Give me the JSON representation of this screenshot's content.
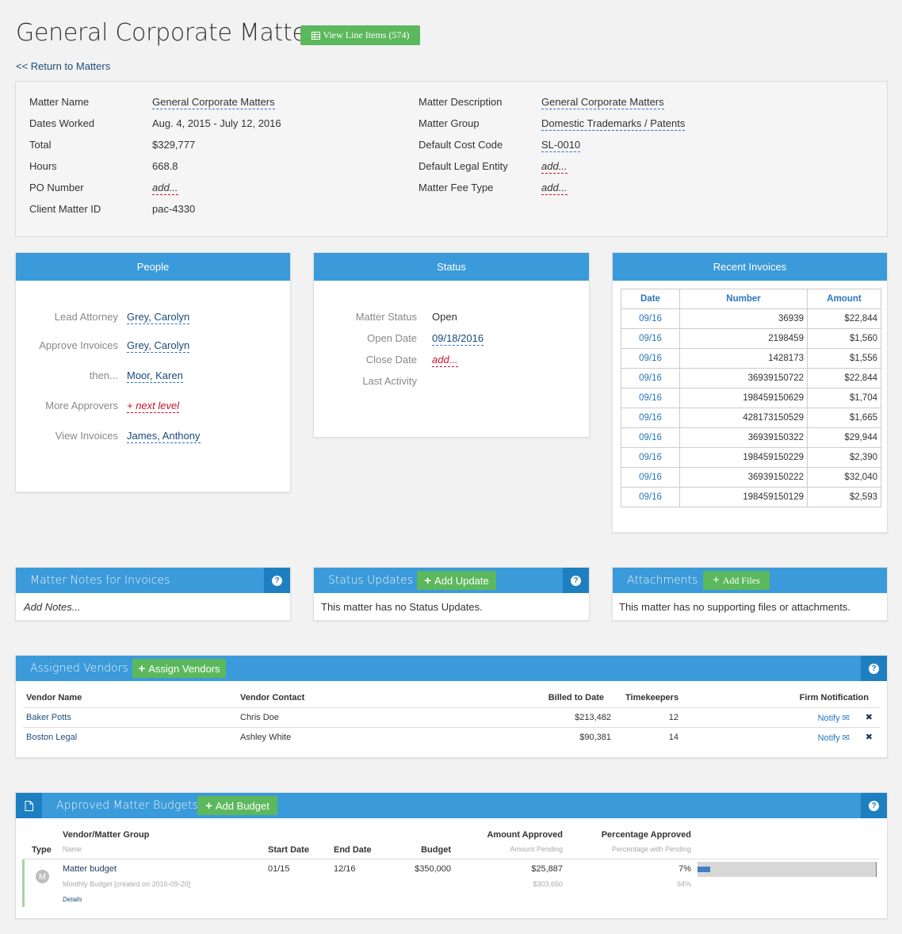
{
  "header": {
    "title": "General Corporate Matters",
    "view_line_items": "View Line Items (574)",
    "return_link": "<< Return to Matters"
  },
  "details": {
    "left": [
      {
        "label": "Matter Name",
        "value": "General Corporate Matters"
      },
      {
        "label": "Dates Worked",
        "value": "Aug. 4, 2015 - July 12, 2016"
      },
      {
        "label": "Total",
        "value": "$329,777"
      },
      {
        "label": "Hours",
        "value": "668.8"
      },
      {
        "label": "PO Number",
        "value": "add..."
      },
      {
        "label": "Client Matter ID",
        "value": "pac-4330"
      }
    ],
    "right": [
      {
        "label": "Matter Description",
        "value": "General Corporate Matters"
      },
      {
        "label": "Matter Group",
        "value": "Domestic Trademarks / Patents"
      },
      {
        "label": "Default Cost Code",
        "value": "SL-0010"
      },
      {
        "label": "Default Legal Entity",
        "value": "add..."
      },
      {
        "label": "Matter Fee Type",
        "value": "add..."
      }
    ]
  },
  "people": {
    "title": "People",
    "rows": [
      {
        "label": "Lead Attorney",
        "value": "Grey, Carolyn"
      },
      {
        "label": "Approve Invoices",
        "value": "Grey, Carolyn"
      },
      {
        "label": "then...",
        "value": "Moor, Karen"
      },
      {
        "label": "More Approvers",
        "value": "+ next level"
      },
      {
        "label": "View Invoices",
        "value": "James, Anthony"
      }
    ]
  },
  "status": {
    "title": "Status",
    "rows": [
      {
        "label": "Matter Status",
        "value": "Open"
      },
      {
        "label": "Open Date",
        "value": "09/18/2016"
      },
      {
        "label": "Close Date",
        "value": "add..."
      },
      {
        "label": "Last Activity",
        "value": ""
      }
    ]
  },
  "invoices": {
    "title": "Recent Invoices",
    "columns": [
      "Date",
      "Number",
      "Amount"
    ],
    "rows": [
      [
        "09/16",
        "36939",
        "$22,844"
      ],
      [
        "09/16",
        "2198459",
        "$1,560"
      ],
      [
        "09/16",
        "1428173",
        "$1,556"
      ],
      [
        "09/16",
        "36939150722",
        "$22,844"
      ],
      [
        "09/16",
        "198459150629",
        "$1,704"
      ],
      [
        "09/16",
        "428173150529",
        "$1,665"
      ],
      [
        "09/16",
        "36939150322",
        "$29,944"
      ],
      [
        "09/16",
        "198459150229",
        "$2,390"
      ],
      [
        "09/16",
        "36939150222",
        "$32,040"
      ],
      [
        "09/16",
        "198459150129",
        "$2,593"
      ]
    ]
  },
  "notes": {
    "title": "Matter Notes for Invoices",
    "placeholder": "Add Notes..."
  },
  "status_updates": {
    "title": "Status Updates",
    "add_label": "Add Update",
    "empty": "This matter has no Status Updates."
  },
  "attachments": {
    "title": "Attachments",
    "add_label": "Add Files",
    "empty": "This matter has no supporting files or attachments."
  },
  "vendors": {
    "title": "Assigned Vendors",
    "assign_label": "Assign Vendors",
    "columns": {
      "name": "Vendor Name",
      "contact": "Vendor Contact",
      "billed": "Billed to Date",
      "timekeepers": "Timekeepers",
      "notify": "Firm Notification"
    },
    "rows": [
      {
        "name": "Baker Potts",
        "contact": "Chris Doe",
        "billed": "$213,482",
        "timekeepers": "12",
        "notify": "Notify"
      },
      {
        "name": "Boston Legal",
        "contact": "Ashley White",
        "billed": "$90,381",
        "timekeepers": "14",
        "notify": "Notify"
      }
    ]
  },
  "budgets": {
    "title": "Approved Matter Budgets",
    "add_label": "Add Budget",
    "columns": {
      "type": "Type",
      "group": "Vendor/Matter Group",
      "group_sub": "Name",
      "start": "Start Date",
      "end": "End Date",
      "budget": "Budget",
      "amount": "Amount Approved",
      "amount_sub": "Amount Pending",
      "pct": "Percentage Approved",
      "pct_sub": "Percentage with Pending"
    },
    "rows": [
      {
        "type_letter": "M",
        "name": "Matter budget",
        "sub": "Monthly Budget [created on 2016-09-20]",
        "details": "Details",
        "start": "01/15",
        "end": "12/16",
        "budget": "$350,000",
        "approved": "$25,887",
        "pending": "$303,650",
        "pct": "7%",
        "pct_pending": "94%",
        "pct_value": 0.07
      }
    ]
  },
  "colors": {
    "accent": "#3b9ad9",
    "accent_dark": "#1e7fc0",
    "green": "#5cb85c",
    "link": "#1f4e79",
    "red": "#c8102e"
  }
}
